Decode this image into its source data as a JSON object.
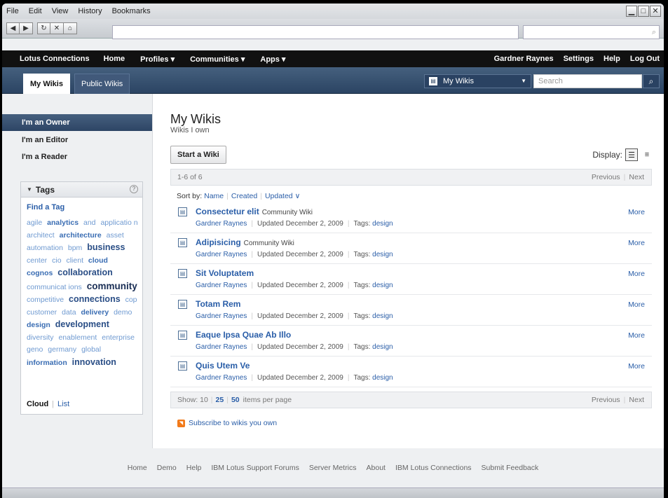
{
  "browser": {
    "menu": [
      "File",
      "Edit",
      "View",
      "History",
      "Bookmarks"
    ],
    "url": "",
    "search_placeholder": ""
  },
  "topnav": {
    "brand": "Lotus Connections",
    "items": [
      "Home",
      "Profiles ▾",
      "Communities ▾",
      "Apps ▾"
    ],
    "user": "Gardner Raynes",
    "settings": "Settings",
    "help": "Help",
    "logout": "Log Out"
  },
  "tabs": {
    "my_wikis": "My Wikis",
    "public_wikis": "Public Wikis"
  },
  "search": {
    "scope": "My Wikis",
    "placeholder": "Search"
  },
  "sidebar": {
    "items": [
      "I'm an Owner",
      "I'm an Editor",
      "I'm a Reader"
    ],
    "tags_title": "Tags",
    "find_tag": "Find a Tag",
    "tags": [
      {
        "t": "agile",
        "w": 1
      },
      {
        "t": "analytics",
        "w": 2
      },
      {
        "t": "and",
        "w": 1
      },
      {
        "t": "applicatio n",
        "w": 1
      },
      {
        "t": "architect",
        "w": 1
      },
      {
        "t": "architecture",
        "w": 2
      },
      {
        "t": "asset",
        "w": 1
      },
      {
        "t": "automation",
        "w": 1
      },
      {
        "t": "bpm",
        "w": 1
      },
      {
        "t": "business",
        "w": 3
      },
      {
        "t": "center",
        "w": 1
      },
      {
        "t": "cio",
        "w": 1
      },
      {
        "t": "client",
        "w": 1
      },
      {
        "t": "cloud",
        "w": 2
      },
      {
        "t": "cognos",
        "w": 2
      },
      {
        "t": "collaboration",
        "w": 3
      },
      {
        "t": "communicat ions",
        "w": 1
      },
      {
        "t": "community",
        "w": 4
      },
      {
        "t": "competitive",
        "w": 1
      },
      {
        "t": "connections",
        "w": 3
      },
      {
        "t": "cop",
        "w": 1
      },
      {
        "t": "customer",
        "w": 1
      },
      {
        "t": "data",
        "w": 1
      },
      {
        "t": "delivery",
        "w": 2
      },
      {
        "t": "demo",
        "w": 1
      },
      {
        "t": "design",
        "w": 2
      },
      {
        "t": "development",
        "w": 3
      },
      {
        "t": "diversity",
        "w": 1
      },
      {
        "t": "enablement",
        "w": 1
      },
      {
        "t": "enterprise",
        "w": 1
      },
      {
        "t": "geno",
        "w": 1
      },
      {
        "t": "germany",
        "w": 1
      },
      {
        "t": "global",
        "w": 1
      },
      {
        "t": "information",
        "w": 2
      },
      {
        "t": "innovation",
        "w": 3
      }
    ],
    "view_cloud": "Cloud",
    "view_list": "List"
  },
  "main": {
    "title": "My Wikis",
    "subtitle": "Wikis I own",
    "start_button": "Start a Wiki",
    "display_label": "Display:",
    "range": "1-6 of 6",
    "previous": "Previous",
    "next": "Next",
    "sort_label": "Sort by:",
    "sort_name": "Name",
    "sort_created": "Created",
    "sort_updated": "Updated ∨",
    "more": "More",
    "wikis": [
      {
        "title": "Consectetur elit",
        "type": "Community Wiki",
        "owner": "Gardner Raynes",
        "updated": "Updated December 2, 2009",
        "tags_label": "Tags:",
        "tag": "design"
      },
      {
        "title": "Adipisicing",
        "type": "Community Wiki",
        "owner": "Gardner Raynes",
        "updated": "Updated December 2, 2009",
        "tags_label": "Tags:",
        "tag": "design"
      },
      {
        "title": "Sit Voluptatem",
        "type": "",
        "owner": "Gardner Raynes",
        "updated": "Updated December 2, 2009",
        "tags_label": "Tags:",
        "tag": "design"
      },
      {
        "title": "Totam Rem",
        "type": "",
        "owner": "Gardner Raynes",
        "updated": "Updated December 2, 2009",
        "tags_label": "Tags:",
        "tag": "design"
      },
      {
        "title": "Eaque Ipsa Quae Ab Illo",
        "type": "",
        "owner": "Gardner Raynes",
        "updated": "Updated December 2, 2009",
        "tags_label": "Tags:",
        "tag": "design"
      },
      {
        "title": "Quis Utem Ve",
        "type": "",
        "owner": "Gardner Raynes",
        "updated": "Updated December 2, 2009",
        "tags_label": "Tags:",
        "tag": "design"
      }
    ],
    "show_label": "Show: 10",
    "show_25": "25",
    "show_50": "50",
    "per_page": "items per page",
    "subscribe": "Subscribe to wikis you own"
  },
  "footer": [
    "Home",
    "Demo",
    "Help",
    "IBM Lotus Support Forums",
    "Server Metrics",
    "About",
    "IBM Lotus Connections",
    "Submit Feedback"
  ]
}
